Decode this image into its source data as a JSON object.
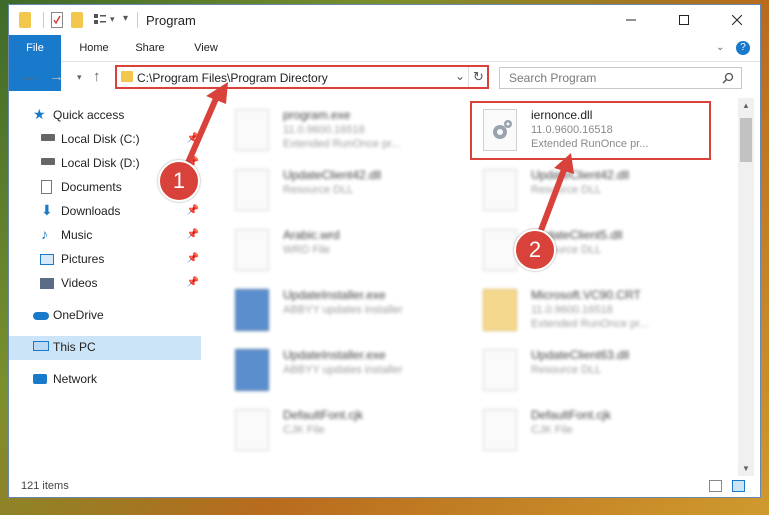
{
  "window": {
    "title": "Program"
  },
  "ribbon": {
    "tabs": [
      "File",
      "Home",
      "Share",
      "View"
    ]
  },
  "address": {
    "path": "C:\\Program Files\\Program Directory"
  },
  "search": {
    "placeholder": "Search Program"
  },
  "nav": {
    "items": [
      {
        "label": "Quick access",
        "icon": "star-icon",
        "pinned": false
      },
      {
        "label": "Local Disk (C:)",
        "icon": "drive-icon",
        "pinned": true
      },
      {
        "label": "Local Disk (D:)",
        "icon": "drive-icon",
        "pinned": true
      },
      {
        "label": "Documents",
        "icon": "documents-icon",
        "pinned": true
      },
      {
        "label": "Downloads",
        "icon": "download-arrow-icon",
        "pinned": true
      },
      {
        "label": "Music",
        "icon": "music-note-icon",
        "pinned": true
      },
      {
        "label": "Pictures",
        "icon": "pictures-icon",
        "pinned": true
      },
      {
        "label": "Videos",
        "icon": "film-icon",
        "pinned": true
      },
      {
        "label": "OneDrive",
        "icon": "cloud-icon",
        "pinned": false
      },
      {
        "label": "This PC",
        "icon": "monitor-icon",
        "pinned": false
      },
      {
        "label": "Network",
        "icon": "network-icon",
        "pinned": false
      }
    ]
  },
  "files": [
    {
      "name": "program.exe",
      "line2": "11.0.9600.16518",
      "line3": "Extended RunOnce pr..."
    },
    {
      "name": "iernonce.dll",
      "line2": "11.0.9600.16518",
      "line3": "Extended RunOnce pr..."
    },
    {
      "name": "UpdateClient42.dll",
      "line2": "Resource DLL",
      "line3": ""
    },
    {
      "name": "UpdateClient42.dll",
      "line2": "Resource DLL",
      "line3": ""
    },
    {
      "name": "Arabic.wrd",
      "line2": "WRD File",
      "line3": ""
    },
    {
      "name": "UpdateClient5.dll",
      "line2": "Resource DLL",
      "line3": ""
    },
    {
      "name": "UpdateInstaller.exe",
      "line2": "ABBYY updates installer",
      "line3": ""
    },
    {
      "name": "Microsoft.VC90.CRT",
      "line2": "11.0.9600.16518",
      "line3": "Extended RunOnce pr..."
    },
    {
      "name": "UpdateInstaller.exe",
      "line2": "ABBYY updates installer",
      "line3": ""
    },
    {
      "name": "UpdateClient63.dll",
      "line2": "Resource DLL",
      "line3": ""
    },
    {
      "name": "DefaultFont.cjk",
      "line2": "CJK File",
      "line3": ""
    },
    {
      "name": "DefaultFont.cjk",
      "line2": "CJK File",
      "line3": ""
    }
  ],
  "status": {
    "count": "121 items"
  },
  "callouts": [
    "1",
    "2"
  ],
  "colors": {
    "accent": "#1979ca",
    "highlight": "#d9423a"
  }
}
